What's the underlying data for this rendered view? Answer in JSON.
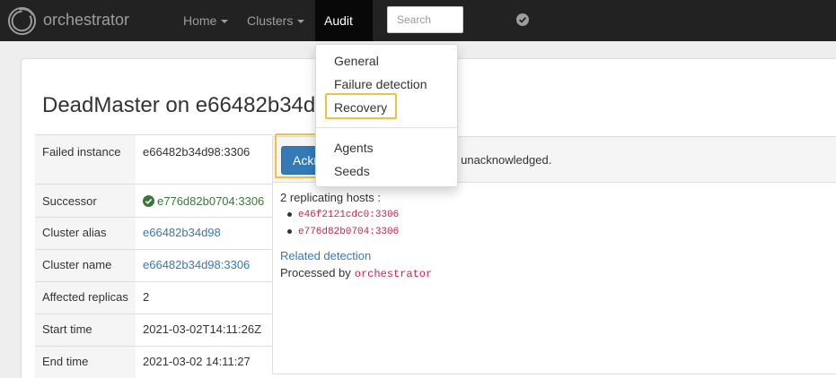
{
  "navbar": {
    "brand": "orchestrator",
    "home_label": "Home",
    "clusters_label": "Clusters",
    "audit_label": "Audit",
    "search_placeholder": "Search",
    "status_icon": "check-circle-icon"
  },
  "audit_menu": {
    "items": [
      "General",
      "Failure detection",
      "Recovery"
    ],
    "items2": [
      "Agents",
      "Seeds"
    ],
    "highlighted": "Recovery",
    "highlight_color": "#f0c040"
  },
  "page": {
    "title": "DeadMaster on e66482b34d98:3306"
  },
  "info": {
    "rows": [
      {
        "label": "Failed instance",
        "value": "e66482b34d98:3306"
      },
      {
        "label": "Successor",
        "value": "e776d82b0704:3306"
      },
      {
        "label": "Cluster alias",
        "value": "e66482b34d98"
      },
      {
        "label": "Cluster name",
        "value": "e66482b34d98:3306"
      },
      {
        "label": "Affected replicas",
        "value": "2"
      },
      {
        "label": "Start time",
        "value": "2021-03-02T14:11:26Z"
      },
      {
        "label": "End time",
        "value": "2021-03-02 14:11:27"
      }
    ]
  },
  "recovery": {
    "ack_button": "Acknowledge",
    "unack_text": "s unacknowledged.",
    "replicating_hosts": "2 replicating hosts :",
    "hosts": [
      "e46f2121cdc0:3306",
      "e776d82b0704:3306"
    ],
    "related_link": "Related detection",
    "processed_by_label": "Processed by",
    "processed_by": "orchestrator"
  },
  "colors": {
    "navbar": "#222222",
    "link": "#337ab7",
    "success": "#3c763d",
    "code": "#c7254e",
    "primary": "#337ab7"
  }
}
